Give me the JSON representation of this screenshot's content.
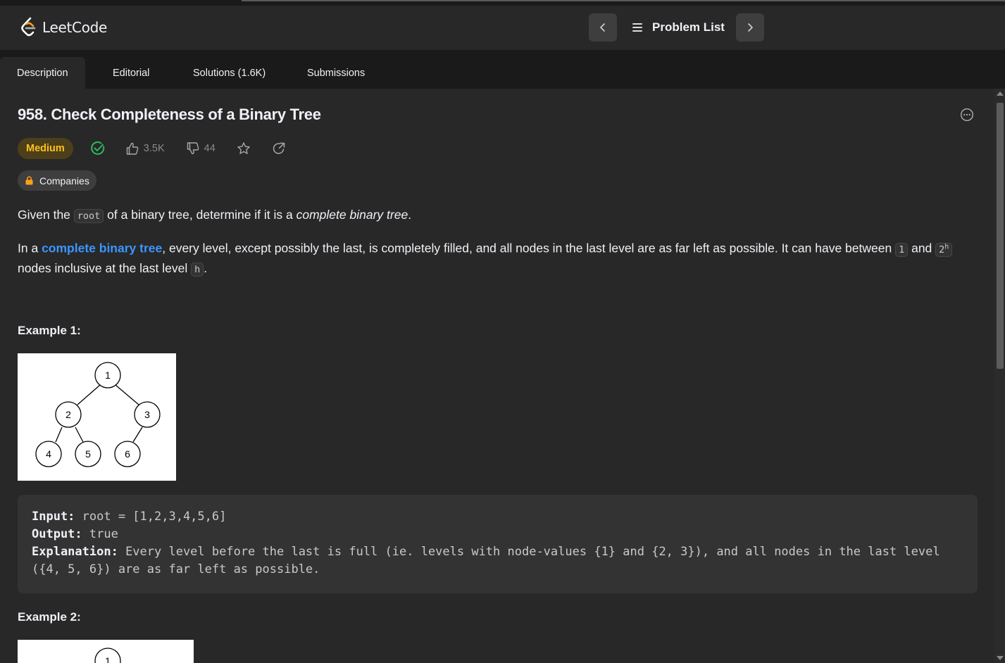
{
  "navbar": {
    "brand": "LeetCode",
    "problem_list_label": "Problem List"
  },
  "tabs": {
    "description": "Description",
    "editorial": "Editorial",
    "solutions": "Solutions (1.6K)",
    "submissions": "Submissions"
  },
  "problem": {
    "title": "958. Check Completeness of a Binary Tree",
    "difficulty": "Medium",
    "likes": "3.5K",
    "dislikes": "44",
    "companies_label": "Companies",
    "p1": {
      "t1": "Given the ",
      "code_root": "root",
      "t2": " of a binary tree, determine if it is a ",
      "em": "complete binary tree",
      "t3": "."
    },
    "p2": {
      "t1": "In a ",
      "link": "complete binary tree",
      "t2": ", every level, except possibly the last, is completely filled, and all nodes in the last level are as far left as possible. It can have between ",
      "code_one": "1",
      "t3": " and ",
      "code_two": "2",
      "sup_h": "h",
      "t4": " nodes inclusive at the last level ",
      "code_h": "h",
      "t5": "."
    }
  },
  "example1": {
    "heading": "Example 1:",
    "tree_nodes": [
      "1",
      "2",
      "3",
      "4",
      "5",
      "6"
    ],
    "input_label": "Input:",
    "input_value": " root = [1,2,3,4,5,6]",
    "output_label": "Output:",
    "output_value": " true",
    "explanation_label": "Explanation:",
    "explanation_value": " Every level before the last is full (ie. levels with node-values {1} and {2, 3}), and all nodes in the last level ({4, 5, 6}) are as far left as possible."
  },
  "example2": {
    "heading": "Example 2:",
    "tree_nodes": [
      "1"
    ]
  },
  "colors": {
    "background": "#282828",
    "accent_link": "#3a96ff",
    "difficulty_medium": "#ffc01e",
    "solved_green": "#2cbb5d"
  }
}
